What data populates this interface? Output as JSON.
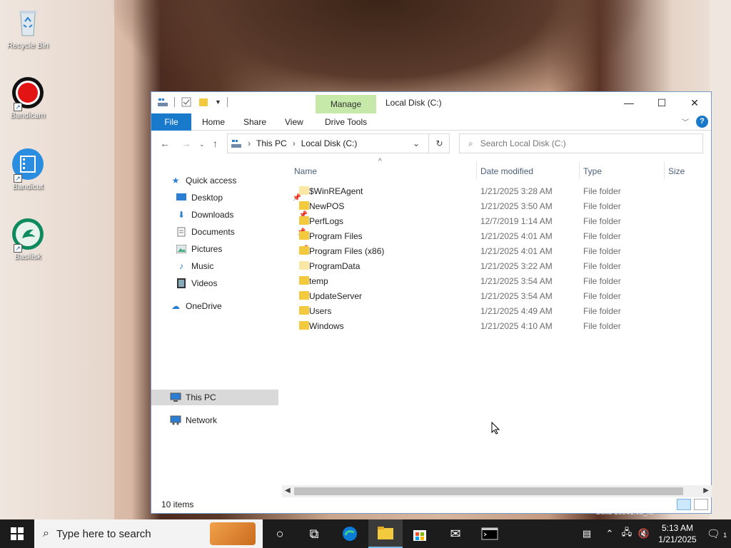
{
  "desktop": {
    "icons": [
      {
        "label": "Recycle Bin"
      },
      {
        "label": "Bandicam"
      },
      {
        "label": "Bandicut"
      },
      {
        "label": "Basilisk"
      }
    ]
  },
  "window": {
    "title": "Local Disk (C:)",
    "manage_tab": "Manage",
    "controls": {
      "minimize": "—",
      "maximize": "☐",
      "close": "✕"
    },
    "ribbon_tabs": [
      "File",
      "Home",
      "Share",
      "View",
      "Drive Tools"
    ],
    "help_label": "?",
    "address": {
      "root": "This PC",
      "current": "Local Disk (C:)"
    },
    "search_placeholder": "Search Local Disk (C:)",
    "nav": {
      "quick_access": "Quick access",
      "desktop": "Desktop",
      "downloads": "Downloads",
      "documents": "Documents",
      "pictures": "Pictures",
      "music": "Music",
      "videos": "Videos",
      "onedrive": "OneDrive",
      "this_pc": "This PC",
      "network": "Network"
    },
    "columns": {
      "name": "Name",
      "date": "Date modified",
      "type": "Type",
      "size": "Size"
    },
    "files": [
      {
        "name": "$WinREAgent",
        "date": "1/21/2025 3:28 AM",
        "type": "File folder"
      },
      {
        "name": "NewPOS",
        "date": "1/21/2025 3:50 AM",
        "type": "File folder"
      },
      {
        "name": "PerfLogs",
        "date": "12/7/2019 1:14 AM",
        "type": "File folder"
      },
      {
        "name": "Program Files",
        "date": "1/21/2025 4:01 AM",
        "type": "File folder"
      },
      {
        "name": "Program Files (x86)",
        "date": "1/21/2025 4:01 AM",
        "type": "File folder"
      },
      {
        "name": "ProgramData",
        "date": "1/21/2025 3:22 AM",
        "type": "File folder"
      },
      {
        "name": "temp",
        "date": "1/21/2025 3:54 AM",
        "type": "File folder"
      },
      {
        "name": "UpdateServer",
        "date": "1/21/2025 3:54 AM",
        "type": "File folder"
      },
      {
        "name": "Users",
        "date": "1/21/2025 4:49 AM",
        "type": "File folder"
      },
      {
        "name": "Windows",
        "date": "1/21/2025 4:10 AM",
        "type": "File folder"
      }
    ],
    "status": "10 items"
  },
  "taskbar": {
    "search_placeholder": "Type here to search",
    "time": "5:13 AM",
    "date": "1/21/2025",
    "notification_count": "1",
    "watermark": "Build 19041.vb_re"
  }
}
